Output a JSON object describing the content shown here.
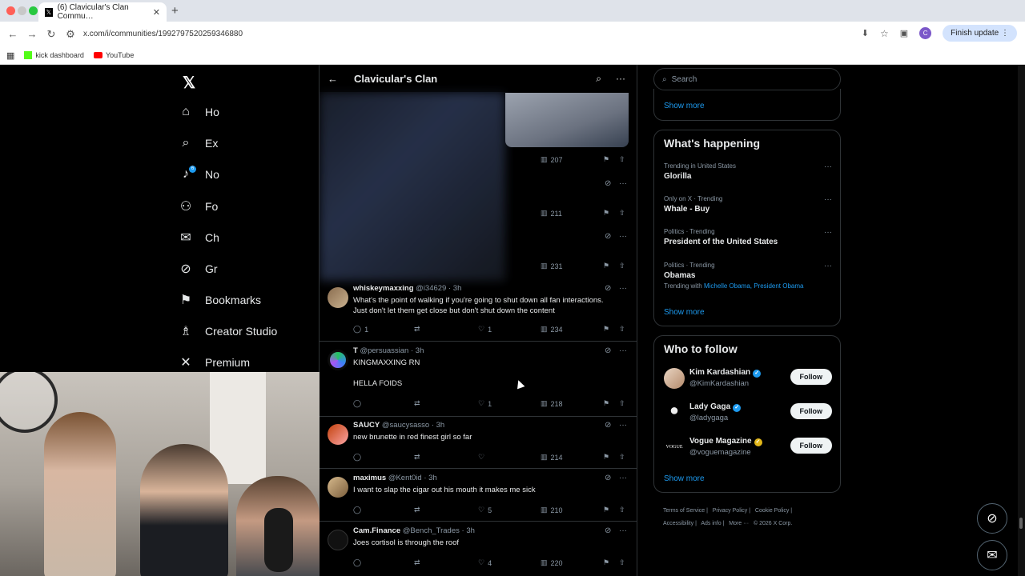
{
  "browser": {
    "tab_title": "(6) Clavicular's Clan Commu…",
    "url": "x.com/i/communities/1992797520259346880",
    "finish_update": "Finish update",
    "profile_initial": "C",
    "bookmarks": [
      {
        "label": "kick dashboard"
      },
      {
        "label": "YouTube"
      }
    ]
  },
  "nav": {
    "items": [
      {
        "label": "Ho",
        "icon": "home-icon"
      },
      {
        "label": "Ex",
        "icon": "search-icon"
      },
      {
        "label": "No",
        "icon": "bell-icon",
        "badge": "6"
      },
      {
        "label": "Fo",
        "icon": "follow-icon"
      },
      {
        "label": "Ch",
        "icon": "mail-icon"
      },
      {
        "label": "Gr",
        "icon": "grok-icon"
      },
      {
        "label": "Bookmarks",
        "icon": "bookmark-icon"
      },
      {
        "label": "Creator Studio",
        "icon": "creator-icon"
      },
      {
        "label": "Premium",
        "icon": "x-icon"
      }
    ]
  },
  "feed": {
    "title": "Clavicular's Clan",
    "blurred_views": [
      "207",
      "211",
      "231"
    ],
    "posts": [
      {
        "name": "whiskeymaxxing",
        "handle": "@i34629",
        "time": "3h",
        "text": "What's the point of walking if you're going to shut down all fan interactions.\nJust don't let them get close but don't shut down the content",
        "replies": "1",
        "likes": "1",
        "views": "234"
      },
      {
        "name": "T",
        "handle": "@persuassian",
        "time": "3h",
        "text": "KINGMAXXING RN\n\nHELLA FOIDS",
        "replies": "",
        "likes": "1",
        "views": "218"
      },
      {
        "name": "SAUCY",
        "handle": "@saucysasso",
        "time": "3h",
        "text": "new brunette in red finest girl so far",
        "replies": "",
        "likes": "",
        "views": "214"
      },
      {
        "name": "maximus",
        "handle": "@Kent0id",
        "time": "3h",
        "text": "I want to slap the cigar out his mouth it makes me sick",
        "replies": "",
        "likes": "5",
        "views": "210"
      },
      {
        "name": "Cam.Finance",
        "handle": "@Bench_Trades",
        "time": "3h",
        "text": "Joes cortisol is through the roof",
        "replies": "",
        "likes": "4",
        "views": "220"
      }
    ]
  },
  "sidebar": {
    "search_placeholder": "Search",
    "show_more": "Show more",
    "happening_title": "What's happening",
    "trends": [
      {
        "category": "Trending in United States",
        "name": "Glorilla",
        "with": ""
      },
      {
        "category": "Only on X · Trending",
        "name": "Whale - Buy",
        "with": ""
      },
      {
        "category": "Politics · Trending",
        "name": "President of the United States",
        "with": ""
      },
      {
        "category": "Politics · Trending",
        "name": "Obamas",
        "with_label": "Trending with",
        "with": "Michelle Obama, President Obama"
      }
    ],
    "who_title": "Who to follow",
    "follow_label": "Follow",
    "who": [
      {
        "name": "Kim Kardashian",
        "handle": "@KimKardashian",
        "badge": "blue"
      },
      {
        "name": "Lady Gaga",
        "handle": "@ladygaga",
        "badge": "blue"
      },
      {
        "name": "Vogue Magazine",
        "handle": "@voguemagazine",
        "badge": "gold"
      }
    ],
    "footer": [
      "Terms of Service",
      "Privacy Policy",
      "Cookie Policy",
      "Accessibility",
      "Ads info",
      "More ···",
      "© 2026 X Corp."
    ]
  }
}
